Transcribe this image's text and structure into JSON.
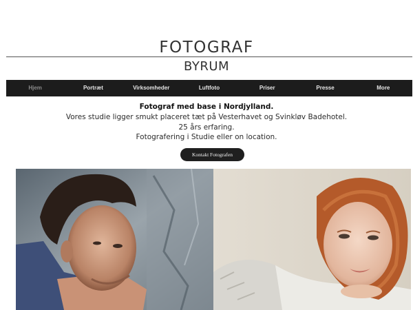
{
  "header": {
    "title": "FOTOGRAF",
    "subtitle": "BYRUM"
  },
  "nav": {
    "items": [
      {
        "label": "Hjem",
        "active": true
      },
      {
        "label": "Portræt",
        "active": false
      },
      {
        "label": "Virksomheder",
        "active": false
      },
      {
        "label": "Luftfoto",
        "active": false
      },
      {
        "label": "Priser",
        "active": false
      },
      {
        "label": "Presse",
        "active": false
      },
      {
        "label": "More",
        "active": false
      }
    ]
  },
  "intro": {
    "headline": "Fotograf med base i Nordjylland.",
    "line1": "Vores studie ligger smukt placeret tæt på Vesterhavet og Svinkløv Badehotel.",
    "line2": "25 års erfaring.",
    "line3": "Fotografering i Studie eller on location."
  },
  "cta": {
    "label": "Kontakt Fotografen"
  },
  "colors": {
    "nav_bg": "#1c1c1c",
    "nav_text": "#e6e6e6",
    "nav_active": "#8a8a8a",
    "button_bg": "#1f1f1f"
  }
}
